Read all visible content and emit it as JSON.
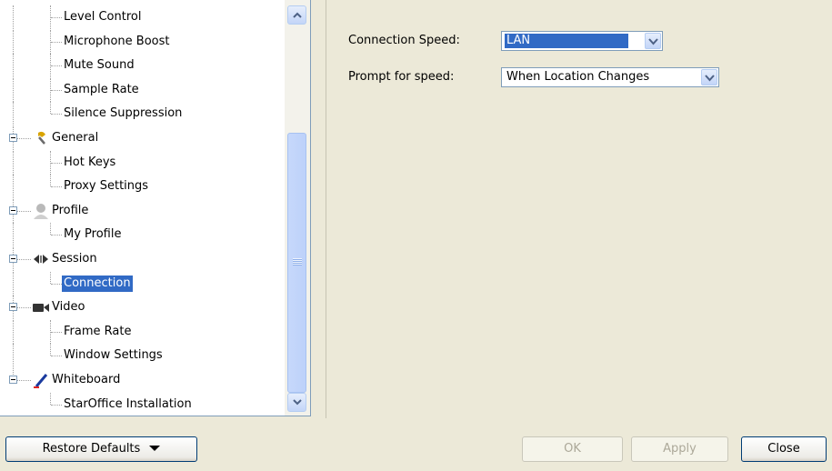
{
  "tree": {
    "items": [
      {
        "label": "Level Control",
        "level": 1,
        "kind": "leaf"
      },
      {
        "label": "Microphone Boost",
        "level": 1,
        "kind": "leaf"
      },
      {
        "label": "Mute Sound",
        "level": 1,
        "kind": "leaf"
      },
      {
        "label": "Sample Rate",
        "level": 1,
        "kind": "leaf"
      },
      {
        "label": "Silence Suppression",
        "level": 1,
        "kind": "leaf-last"
      },
      {
        "label": "General",
        "level": 0,
        "kind": "group",
        "icon": "general-icon"
      },
      {
        "label": "Hot Keys",
        "level": 1,
        "kind": "leaf"
      },
      {
        "label": "Proxy Settings",
        "level": 1,
        "kind": "leaf-last"
      },
      {
        "label": "Profile",
        "level": 0,
        "kind": "group",
        "icon": "profile-icon"
      },
      {
        "label": "My Profile",
        "level": 1,
        "kind": "leaf-last"
      },
      {
        "label": "Session",
        "level": 0,
        "kind": "group",
        "icon": "session-icon"
      },
      {
        "label": "Connection",
        "level": 1,
        "kind": "leaf-last",
        "selected": true
      },
      {
        "label": "Video",
        "level": 0,
        "kind": "group",
        "icon": "video-camera-icon"
      },
      {
        "label": "Frame Rate",
        "level": 1,
        "kind": "leaf"
      },
      {
        "label": "Window Settings",
        "level": 1,
        "kind": "leaf-last"
      },
      {
        "label": "Whiteboard",
        "level": 0,
        "kind": "group",
        "icon": "whiteboard-pen-icon"
      },
      {
        "label": "StarOffice Installation",
        "level": 1,
        "kind": "leaf-last"
      }
    ]
  },
  "settings": {
    "connection_speed_label": "Connection Speed:",
    "connection_speed_value": "LAN",
    "prompt_speed_label": "Prompt for speed:",
    "prompt_speed_value": "When Location Changes"
  },
  "footer": {
    "restore_defaults_label": "Restore Defaults",
    "ok_label": "OK",
    "apply_label": "Apply",
    "close_label": "Close"
  },
  "colors": {
    "selection": "#316ac5",
    "window_bg": "#ece9d8"
  }
}
